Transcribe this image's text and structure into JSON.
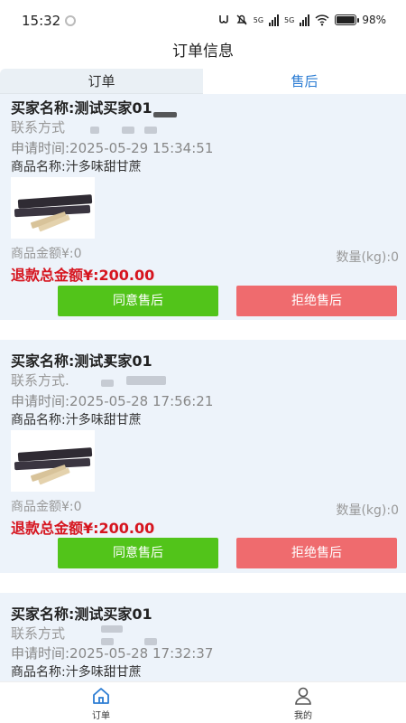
{
  "status": {
    "time": "15:32",
    "network": "5G",
    "battery": "98%"
  },
  "header": {
    "title": "订单信息"
  },
  "tabs": [
    {
      "label": "订单",
      "active": false
    },
    {
      "label": "售后",
      "active": true
    }
  ],
  "orders": [
    {
      "buyer": "买家名称:测试买家01",
      "contact": "联系方式",
      "apply_time": "申请时间:2025-05-29 15:34:51",
      "product": "商品名称:汁多味甜甘蔗",
      "amount": "商品金额¥:0",
      "quantity": "数量(kg):0",
      "refund": "退款总金额¥:200.00",
      "agree_label": "同意售后",
      "reject_label": "拒绝售后"
    },
    {
      "buyer": "买家名称:测试买家01",
      "contact": "联系方式.",
      "apply_time": "申请时间:2025-05-28 17:56:21",
      "product": "商品名称:汁多味甜甘蔗",
      "amount": "商品金额¥:0",
      "quantity": "数量(kg):0",
      "refund": "退款总金额¥:200.00",
      "agree_label": "同意售后",
      "reject_label": "拒绝售后"
    },
    {
      "buyer": "买家名称:测试买家01",
      "contact": "联系方式",
      "apply_time": "申请时间:2025-05-28 17:32:37",
      "product": "商品名称:汁多味甜甘蔗"
    }
  ],
  "tabbar": [
    {
      "label": "订单",
      "icon": "home-icon"
    },
    {
      "label": "我的",
      "icon": "user-icon"
    }
  ],
  "colors": {
    "card_bg": "#edf3fa",
    "agree": "#52c41a",
    "reject": "#ef6b6e",
    "refund_text": "#d6151f",
    "active_tab_text": "#2b7cd3"
  }
}
